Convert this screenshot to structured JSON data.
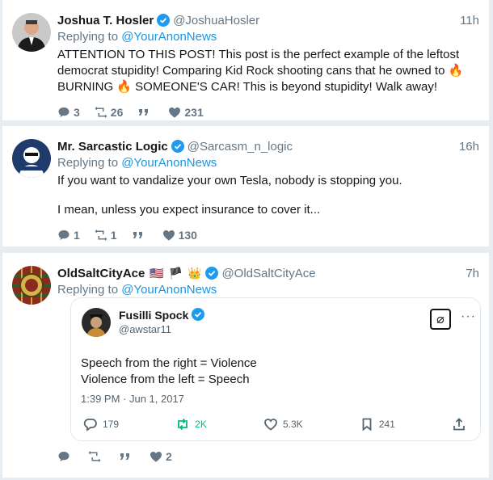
{
  "tweets": [
    {
      "name": "Joshua T. Hosler",
      "handle": "@JoshuaHosler",
      "time": "11h",
      "replying_prefix": "Replying to ",
      "replying_to": "@YourAnonNews",
      "text": "ATTENTION TO THIS POST! This post is the perfect example of the leftost democrat stupidity! Comparing Kid Rock shooting cans that he owned to 🔥 BURNING 🔥 SOMEONE'S CAR! This is beyond stupidity! Walk away!",
      "replies": "3",
      "retweets": "26",
      "likes": "231"
    },
    {
      "name": "Mr. Sarcastic Logic",
      "handle": "@Sarcasm_n_logic",
      "time": "16h",
      "replying_prefix": "Replying to ",
      "replying_to": "@YourAnonNews",
      "text_p1": "If you want to vandalize your own Tesla, nobody is stopping you.",
      "text_p2": "I mean, unless you expect insurance to cover it...",
      "replies": "1",
      "retweets": "1",
      "likes": "130"
    },
    {
      "name": "OldSaltCityAce",
      "flags": "🇺🇸 🏴 👑",
      "handle": "@OldSaltCityAce",
      "time": "7h",
      "replying_prefix": "Replying to ",
      "replying_to": "@YourAnonNews",
      "likes": "2"
    }
  ],
  "quote": {
    "name": "Fusilli Spock",
    "handle": "@awstar11",
    "line1": "Speech from the right = Violence",
    "line2": "Violence from the left = Speech",
    "timestamp": "1:39 PM · Jun 1, 2017",
    "replies": "179",
    "reposts": "2K",
    "likes": "5.3K",
    "bookmarks": "241",
    "x_logo": "⌀",
    "more": "···"
  },
  "colors": {
    "link": "#1b95e0",
    "verified": "#1d9bf0",
    "repost_green": "#00ba7c",
    "bg": "#e6ecf0"
  }
}
